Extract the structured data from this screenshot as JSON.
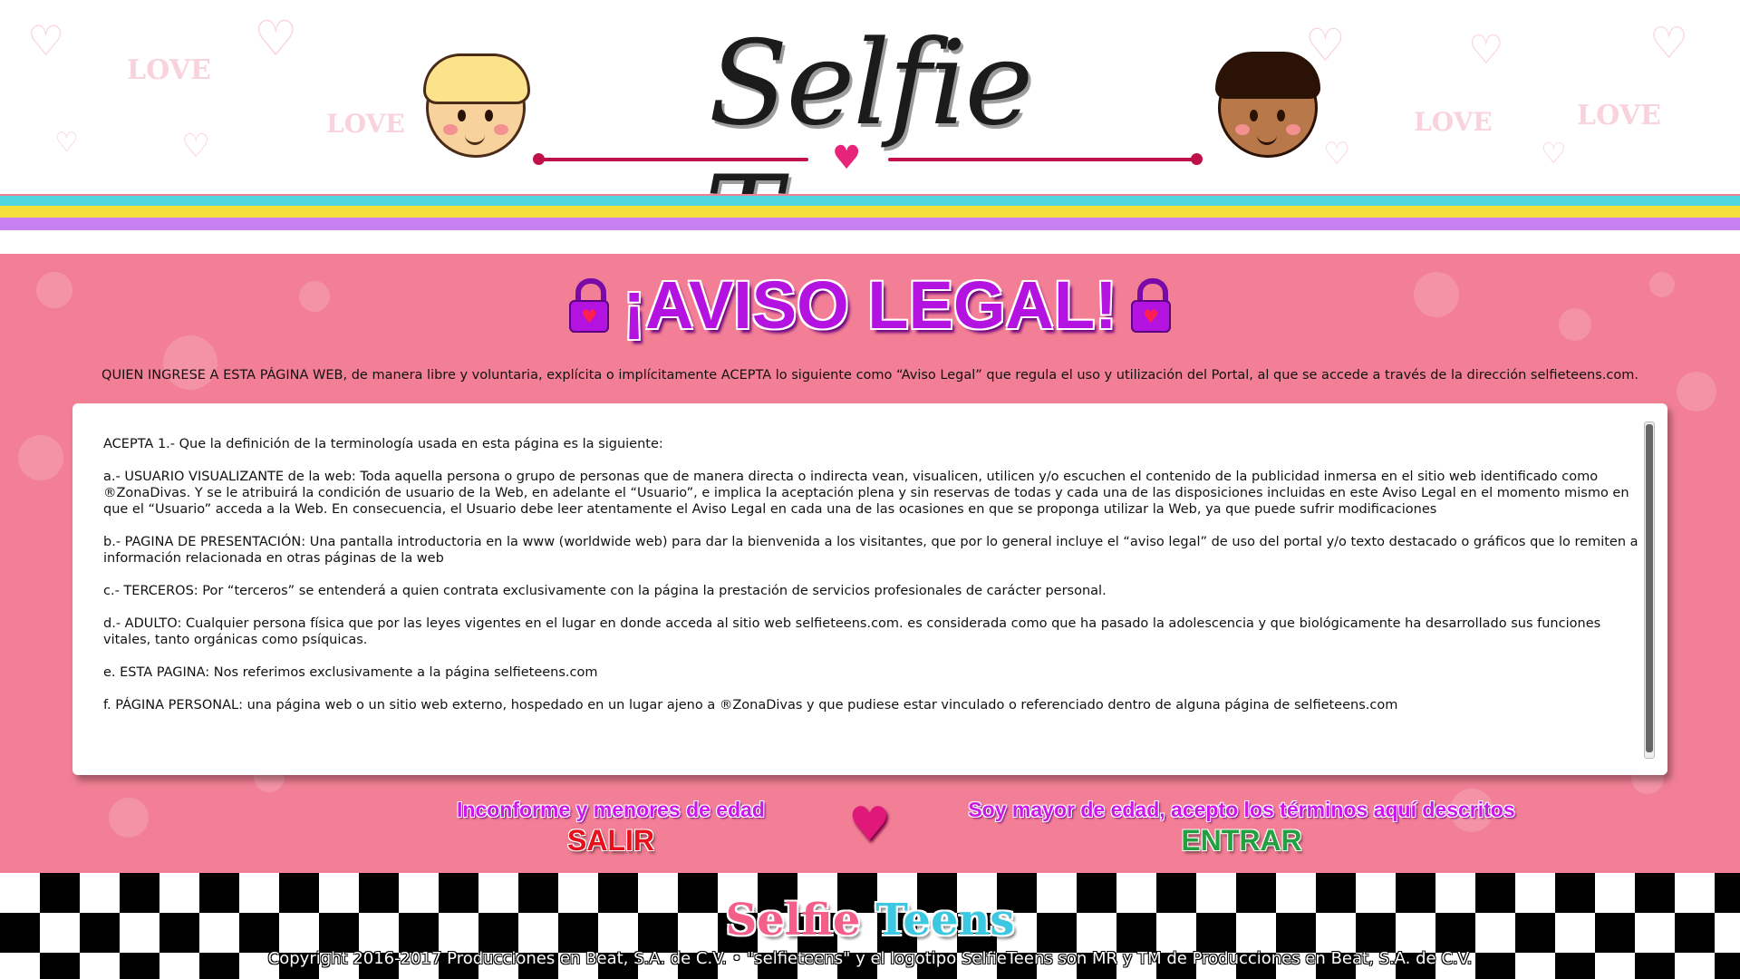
{
  "header": {
    "logo_text": "Selfie Teens",
    "stripe_colors": [
      "#4fd6df",
      "#f5df3a",
      "#c77ff2"
    ]
  },
  "notice": {
    "title": "¡AVISO LEGAL!",
    "intro": "QUIEN INGRESE A ESTA PÁGINA WEB, de manera libre y voluntaria, explícita o implícitamente ACEPTA lo siguiente como “Aviso Legal”  que regula el uso y utilización del Portal, al que se accede a través de la dirección selfieteens.com.",
    "paragraphs": [
      "ACEPTA 1.- Que la definición de la terminología usada en esta página es la siguiente:",
      "a.- USUARIO VISUALIZANTE de la web: Toda aquella persona o grupo de personas que de manera directa o indirecta vean, visualicen, utilicen y/o escuchen el contenido de la publicidad inmersa en el sitio web identificado como ®ZonaDivas. Y se le atribuirá la condición de usuario de la Web, en adelante el “Usuario”, e implica la aceptación plena y sin reservas de todas y cada una de las disposiciones incluidas en este Aviso Legal en el momento mismo en que el “Usuario” acceda a la Web. En consecuencia, el Usuario debe leer atentamente el Aviso Legal en cada una de las ocasiones en que se proponga utilizar la Web, ya que puede sufrir modificaciones",
      "b.- PAGINA DE PRESENTACIÓN: Una pantalla introductoria en la www (worldwide web) para dar la bienvenida a los visitantes, que por lo general incluye el “aviso legal” de uso del portal y/o texto destacado o gráficos que lo remiten a información relacionada en otras páginas de la web",
      "c.- TERCEROS: Por “terceros” se entenderá a quien contrata exclusivamente con la página la prestación de servicios profesionales de carácter personal.",
      "d.- ADULTO: Cualquier persona física que por las leyes vigentes en el lugar en donde acceda al sitio web selfieteens.com. es considerada como que ha pasado la adolescencia y que biológicamente ha desarrollado sus funciones vitales, tanto orgánicas como psíquicas.",
      "e. ESTA PAGINA: Nos referimos exclusivamente a la página selfieteens.com",
      "f. PÁGINA PERSONAL: una página web o un sitio web externo, hospedado en un lugar ajeno a ®ZonaDivas y que pudiese estar vinculado o referenciado dentro de alguna página de selfieteens.com"
    ]
  },
  "choices": {
    "exit_caption": "Inconforme y menores de edad",
    "exit_label": "SALIR",
    "enter_caption": "Soy mayor de edad, acepto los términos aquí descritos",
    "enter_label": "ENTRAR"
  },
  "footer": {
    "logo_part1": "Selfie",
    "logo_part2": "Teens",
    "copyright": "Copyright 2016-2017 Producciones en Beat, S.A. de C.V.  •  \"selfieteens\" y el logotipo SelfieTeens son MR y TM de Producciones en Beat, S.A. de C.V."
  },
  "colors": {
    "background_pink": "#f27f95",
    "title_purple": "#b312e0",
    "exit_red": "#e8101c",
    "enter_green": "#23a040"
  },
  "icons": [
    "padlock-heart-icon",
    "heart-icon",
    "boy-face-icon",
    "girl-face-icon"
  ]
}
